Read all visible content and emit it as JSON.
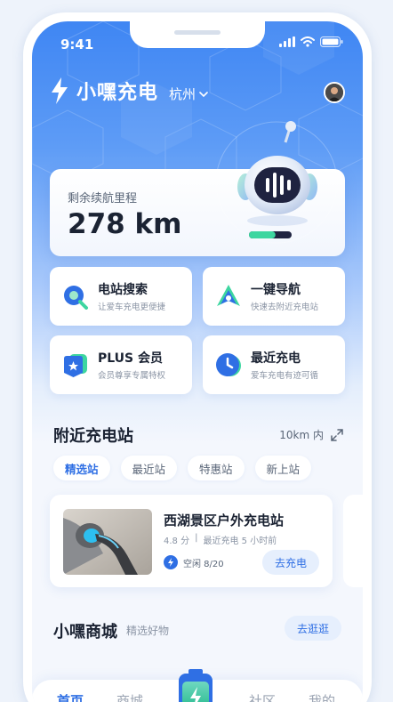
{
  "status_bar": {
    "time": "9:41"
  },
  "header": {
    "brand": "小嘿充电",
    "city": "杭州"
  },
  "range_card": {
    "label": "剩余续航里程",
    "value": "278 km",
    "battery_level": 0.62
  },
  "actions": [
    {
      "title": "电站搜索",
      "subtitle": "让爱车充电更便捷",
      "icon": "search-icon"
    },
    {
      "title": "一键导航",
      "subtitle": "快速去附近充电站",
      "icon": "navigation-icon"
    },
    {
      "title": "PLUS 会员",
      "subtitle": "会员尊享专属特权",
      "icon": "member-badge-icon"
    },
    {
      "title": "最近充电",
      "subtitle": "爱车充电有迹可循",
      "icon": "clock-icon"
    }
  ],
  "nearby": {
    "title": "附近充电站",
    "range": "10km 内",
    "chips": [
      "精选站",
      "最近站",
      "特惠站",
      "新上站"
    ],
    "active_chip": "精选站",
    "station": {
      "name": "西湖景区户外充电站",
      "rating": "4.8 分",
      "last_charge": "最近充电 5 小时前",
      "status": "空闲 8/20",
      "button": "去充电"
    }
  },
  "mall": {
    "title": "小嘿商城",
    "subtitle": "精选好物",
    "button": "去逛逛"
  },
  "tabs": [
    "首页",
    "商城",
    "社区",
    "我的"
  ],
  "active_tab": "首页",
  "colors": {
    "primary": "#2f6fe4",
    "gradient_top": "#3f86f3",
    "background": "#f4f7fd"
  }
}
